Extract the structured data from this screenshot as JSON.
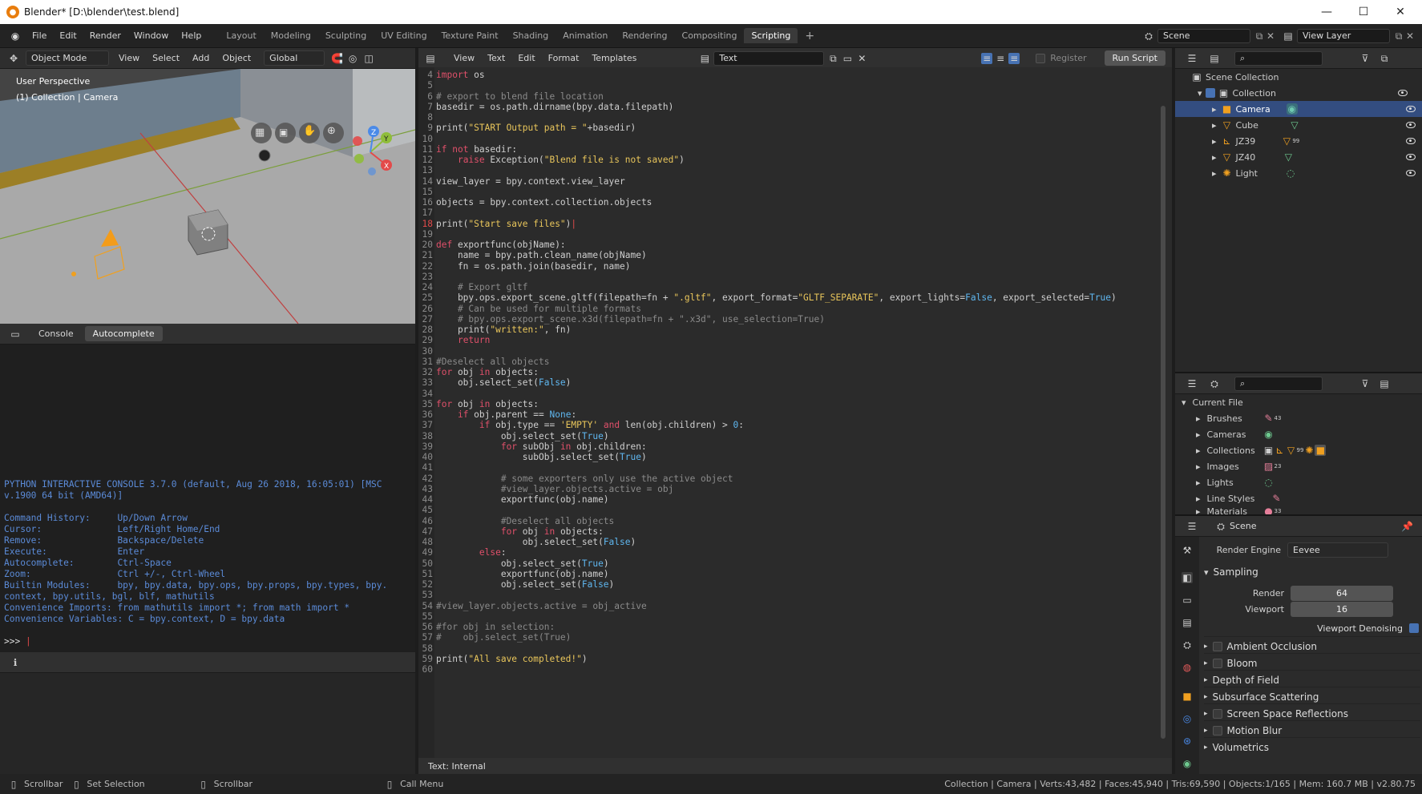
{
  "window": {
    "title": "Blender* [D:\\blender\\test.blend]",
    "minimize": "—",
    "maximize": "☐",
    "close": "✕"
  },
  "menus": [
    "File",
    "Edit",
    "Render",
    "Window",
    "Help"
  ],
  "workspaces": [
    "Layout",
    "Modeling",
    "Sculpting",
    "UV Editing",
    "Texture Paint",
    "Shading",
    "Animation",
    "Rendering",
    "Compositing",
    "Scripting"
  ],
  "active_workspace": "Scripting",
  "scene": {
    "label": "Scene",
    "view_layer": "View Layer"
  },
  "viewport": {
    "mode": "Object Mode",
    "menus": [
      "View",
      "Select",
      "Add",
      "Object"
    ],
    "transform": "Global",
    "overlay_line1": "User Perspective",
    "overlay_line2": "(1) Collection | Camera",
    "gizmo_axes": [
      "X",
      "Y",
      "Z"
    ]
  },
  "text_editor": {
    "menus": [
      "View",
      "Text",
      "Edit",
      "Format",
      "Templates"
    ],
    "text_name": "Text",
    "register_label": "Register",
    "run_label": "Run Script",
    "footer": "Text: Internal",
    "current_line": 18,
    "lines": [
      {
        "n": "4",
        "t": "import os"
      },
      {
        "n": "5",
        "t": ""
      },
      {
        "n": "6",
        "t": "# export to blend file location"
      },
      {
        "n": "7",
        "t": "basedir = os.path.dirname(bpy.data.filepath)"
      },
      {
        "n": "8",
        "t": ""
      },
      {
        "n": "9",
        "t": "print(\"START Output path = \"+basedir)"
      },
      {
        "n": "10",
        "t": ""
      },
      {
        "n": "11",
        "t": "if not basedir:"
      },
      {
        "n": "12",
        "t": "    raise Exception(\"Blend file is not saved\")"
      },
      {
        "n": "13",
        "t": ""
      },
      {
        "n": "14",
        "t": "view_layer = bpy.context.view_layer"
      },
      {
        "n": "15",
        "t": ""
      },
      {
        "n": "16",
        "t": "objects = bpy.context.collection.objects"
      },
      {
        "n": "17",
        "t": ""
      },
      {
        "n": "18",
        "t": "print(\"Start save files\")"
      },
      {
        "n": "19",
        "t": ""
      },
      {
        "n": "20",
        "t": "def exportfunc(objName):"
      },
      {
        "n": "21",
        "t": "    name = bpy.path.clean_name(objName)"
      },
      {
        "n": "22",
        "t": "    fn = os.path.join(basedir, name)"
      },
      {
        "n": "23",
        "t": ""
      },
      {
        "n": "24",
        "t": "    # Export gltf"
      },
      {
        "n": "25",
        "t": "    bpy.ops.export_scene.gltf(filepath=fn + \".gltf\", export_format=\"GLTF_SEPARATE\", export_lights=False, export_selected=True)"
      },
      {
        "n": "26",
        "t": "    # Can be used for multiple formats"
      },
      {
        "n": "27",
        "t": "    # bpy.ops.export_scene.x3d(filepath=fn + \".x3d\", use_selection=True)"
      },
      {
        "n": "28",
        "t": "    print(\"written:\", fn)"
      },
      {
        "n": "29",
        "t": "    return"
      },
      {
        "n": "30",
        "t": ""
      },
      {
        "n": "31",
        "t": "#Deselect all objects"
      },
      {
        "n": "32",
        "t": "for obj in objects:"
      },
      {
        "n": "33",
        "t": "    obj.select_set(False)"
      },
      {
        "n": "34",
        "t": ""
      },
      {
        "n": "35",
        "t": "for obj in objects:"
      },
      {
        "n": "36",
        "t": "    if obj.parent == None:"
      },
      {
        "n": "37",
        "t": "        if obj.type == 'EMPTY' and len(obj.children) > 0:"
      },
      {
        "n": "38",
        "t": "            obj.select_set(True)"
      },
      {
        "n": "39",
        "t": "            for subObj in obj.children:"
      },
      {
        "n": "40",
        "t": "                subObj.select_set(True)"
      },
      {
        "n": "41",
        "t": ""
      },
      {
        "n": "42",
        "t": "            # some exporters only use the active object"
      },
      {
        "n": "43",
        "t": "            #view_layer.objects.active = obj"
      },
      {
        "n": "44",
        "t": "            exportfunc(obj.name)"
      },
      {
        "n": "45",
        "t": ""
      },
      {
        "n": "46",
        "t": "            #Deselect all objects"
      },
      {
        "n": "47",
        "t": "            for obj in objects:"
      },
      {
        "n": "48",
        "t": "                obj.select_set(False)"
      },
      {
        "n": "49",
        "t": "        else:"
      },
      {
        "n": "50",
        "t": "            obj.select_set(True)"
      },
      {
        "n": "51",
        "t": "            exportfunc(obj.name)"
      },
      {
        "n": "52",
        "t": "            obj.select_set(False)"
      },
      {
        "n": "53",
        "t": ""
      },
      {
        "n": "54",
        "t": "#view_layer.objects.active = obj_active"
      },
      {
        "n": "55",
        "t": ""
      },
      {
        "n": "56",
        "t": "#for obj in selection:"
      },
      {
        "n": "57",
        "t": "#    obj.select_set(True)"
      },
      {
        "n": "58",
        "t": ""
      },
      {
        "n": "59",
        "t": "print(\"All save completed!\")"
      },
      {
        "n": "60",
        "t": ""
      }
    ]
  },
  "console": {
    "tabs": [
      "Console",
      "Autocomplete"
    ],
    "lines": [
      "PYTHON INTERACTIVE CONSOLE 3.7.0 (default, Aug 26 2018, 16:05:01) [MSC",
      "v.1900 64 bit (AMD64)]",
      "",
      "Command History:     Up/Down Arrow",
      "Cursor:              Left/Right Home/End",
      "Remove:              Backspace/Delete",
      "Execute:             Enter",
      "Autocomplete:        Ctrl-Space",
      "Zoom:                Ctrl +/-, Ctrl-Wheel",
      "Builtin Modules:     bpy, bpy.data, bpy.ops, bpy.props, bpy.types, bpy.",
      "context, bpy.utils, bgl, blf, mathutils",
      "Convenience Imports: from mathutils import *; from math import *",
      "Convenience Variables: C = bpy.context, D = bpy.data"
    ],
    "prompt": ">>> "
  },
  "outliner": {
    "root": "Scene Collection",
    "collection": "Collection",
    "items": [
      {
        "label": "Camera",
        "icon": "camera-icon"
      },
      {
        "label": "Cube",
        "icon": "mesh-icon"
      },
      {
        "label": "JZ39",
        "icon": "empty-icon"
      },
      {
        "label": "JZ40",
        "icon": "mesh-icon"
      },
      {
        "label": "Light",
        "icon": "light-icon"
      }
    ],
    "selected": "Camera",
    "badge_jz39": "99"
  },
  "file_browser": {
    "root": "Current File",
    "items": [
      "Brushes",
      "Cameras",
      "Collections",
      "Images",
      "Lights",
      "Line Styles",
      "Materials"
    ],
    "badges": {
      "brushes": "43",
      "images": "23",
      "materials": "33",
      "collections": "99"
    }
  },
  "properties": {
    "context": "Scene",
    "render_engine_label": "Render Engine",
    "render_engine": "Eevee",
    "sampling": "Sampling",
    "render_label": "Render",
    "render_value": "64",
    "viewport_label": "Viewport",
    "viewport_value": "16",
    "denoise_label": "Viewport Denoising",
    "panels": [
      {
        "label": "Ambient Occlusion",
        "check": true
      },
      {
        "label": "Bloom",
        "check": true
      },
      {
        "label": "Depth of Field",
        "check": false
      },
      {
        "label": "Subsurface Scattering",
        "check": false
      },
      {
        "label": "Screen Space Reflections",
        "check": true
      },
      {
        "label": "Motion Blur",
        "check": true
      },
      {
        "label": "Volumetrics",
        "check": false
      }
    ]
  },
  "status": {
    "left1": "Scrollbar",
    "left2": "Set Selection",
    "left3": "Scrollbar",
    "left4": "Call Menu",
    "right": "Collection | Camera | Verts:43,482 | Faces:45,940 | Tris:69,590 | Objects:1/165 | Mem: 160.7 MB | v2.80.75"
  },
  "colors": {
    "accent": "#4772b3",
    "selected": "#334d80",
    "keyword": "#e0506a",
    "string": "#e9c65b",
    "number": "#5fb7f0",
    "comment": "#8a8a8a",
    "console": "#5b8bd8",
    "cursor": "#e04a4a"
  }
}
